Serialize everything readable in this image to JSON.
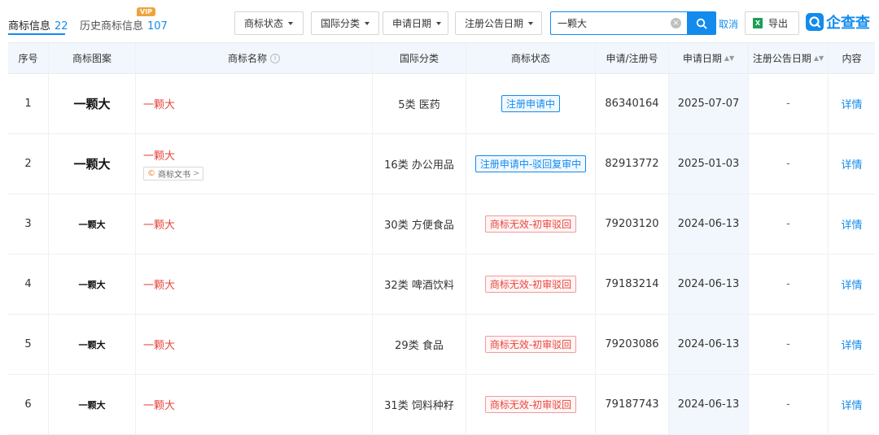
{
  "tabs": {
    "active": {
      "label": "商标信息",
      "count": "22"
    },
    "history": {
      "label": "历史商标信息",
      "count": "107",
      "badge": "VIP"
    }
  },
  "filters": [
    {
      "label": "商标状态"
    },
    {
      "label": "国际分类"
    },
    {
      "label": "申请日期"
    },
    {
      "label": "注册公告日期"
    }
  ],
  "search": {
    "value": "一颗大",
    "clear_icon": "×"
  },
  "actions": {
    "cancel": "取消",
    "export": "导出",
    "excel_icon_text": "X"
  },
  "logo": {
    "text": "企查查"
  },
  "table": {
    "headers": {
      "index": "序号",
      "image": "商标图案",
      "name": "商标名称",
      "class": "国际分类",
      "status": "商标状态",
      "reg_no": "申请/注册号",
      "apply_date": "申请日期",
      "notice_date": "注册公告日期",
      "content": "内容"
    },
    "doc_tag_label": "商标文书",
    "rows": [
      {
        "index": "1",
        "image_text": "一颗大",
        "name": "一颗大",
        "class": "5类 医药",
        "status": "注册申请中",
        "status_type": "blue",
        "reg_no": "86340164",
        "apply_date": "2025-07-07",
        "notice_date": "-",
        "detail": "详情"
      },
      {
        "index": "2",
        "image_text": "一颗大",
        "name": "一颗大",
        "has_doc": true,
        "class": "16类 办公用品",
        "status": "注册申请中-驳回复审中",
        "status_type": "blue",
        "reg_no": "82913772",
        "apply_date": "2025-01-03",
        "notice_date": "-",
        "detail": "详情"
      },
      {
        "index": "3",
        "image_text": "一颗大",
        "name": "一颗大",
        "class": "30类 方便食品",
        "status": "商标无效-初审驳回",
        "status_type": "red",
        "reg_no": "79203120",
        "apply_date": "2024-06-13",
        "notice_date": "-",
        "detail": "详情"
      },
      {
        "index": "4",
        "image_text": "一颗大",
        "name": "一颗大",
        "class": "32类 啤酒饮料",
        "status": "商标无效-初审驳回",
        "status_type": "red",
        "reg_no": "79183214",
        "apply_date": "2024-06-13",
        "notice_date": "-",
        "detail": "详情"
      },
      {
        "index": "5",
        "image_text": "一颗大",
        "name": "一颗大",
        "class": "29类 食品",
        "status": "商标无效-初审驳回",
        "status_type": "red",
        "reg_no": "79203086",
        "apply_date": "2024-06-13",
        "notice_date": "-",
        "detail": "详情"
      },
      {
        "index": "6",
        "image_text": "一颗大",
        "name": "一颗大",
        "class": "31类 饲料种籽",
        "status": "商标无效-初审驳回",
        "status_type": "red",
        "reg_no": "79187743",
        "apply_date": "2024-06-13",
        "notice_date": "-",
        "detail": "详情"
      }
    ]
  },
  "colors": {
    "accent": "#128bed",
    "danger": "#e8453c",
    "header_bg": "#f2f7fd"
  }
}
